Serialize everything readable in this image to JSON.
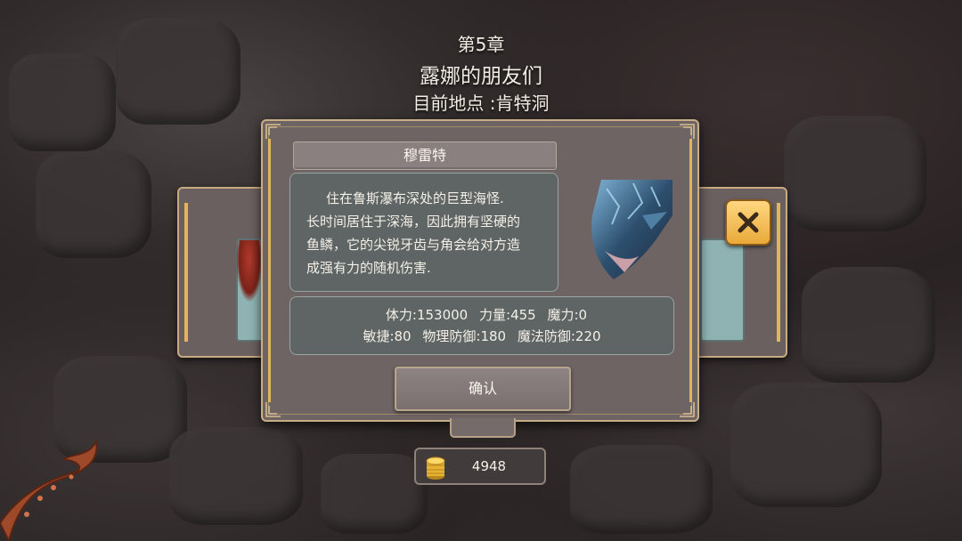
{
  "header": {
    "chapter": "第5章",
    "chapter_title": "露娜的朋友们",
    "location": "目前地点 :肯特洞"
  },
  "dialog": {
    "monster_name": "穆雷特",
    "description_lines": [
      "住在鲁斯瀑布深处的巨型海怪.",
      "长时间居住于深海，因此拥有坚硬的",
      "鱼鳞，它的尖锐牙齿与角会给对方造",
      "成强有力的随机伤害."
    ],
    "stats": {
      "hp": "体力:153000",
      "strength": "力量:455",
      "magic": "魔力:0",
      "agility": "敏捷:80",
      "phys_def": "物理防御:180",
      "magic_def": "魔法防御:220"
    },
    "confirm_label": "确认"
  },
  "currency": {
    "icon": "gold-coin-stack-icon",
    "value": "4948"
  },
  "colors": {
    "panel": "#6f6464",
    "border": "#c9ad86",
    "rail": "#e0b460",
    "close_button": "#f4c15c"
  }
}
